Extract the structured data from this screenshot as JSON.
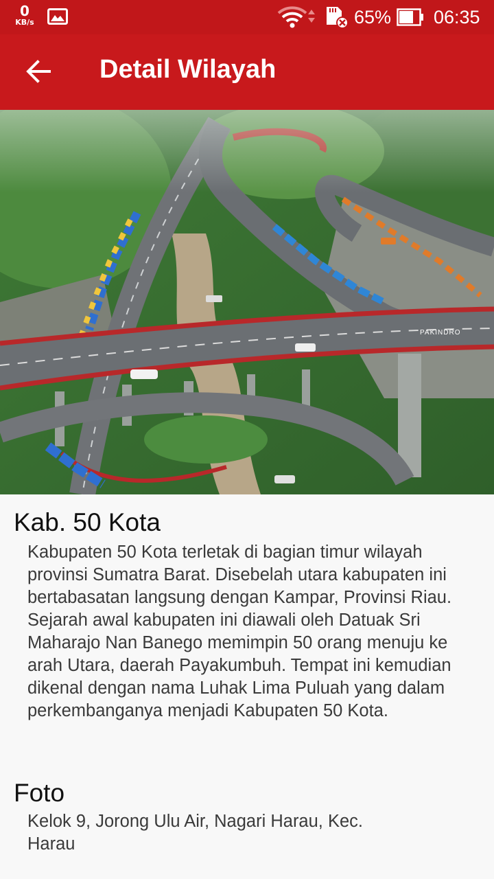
{
  "status_bar": {
    "net_speed_value": "0",
    "net_speed_unit": "KB/s",
    "battery_percent": "65%",
    "time": "06:35",
    "icons": [
      "gallery-icon",
      "wifi-icon",
      "sd-card-icon",
      "battery-icon"
    ]
  },
  "app_bar": {
    "title": "Detail Wilayah",
    "back_icon": "arrow-back-icon"
  },
  "hero": {
    "watermark": "PAKINDRO"
  },
  "detail": {
    "name": "Kab. 50 Kota",
    "description": "Kabupaten 50 Kota terletak di bagian timur wilayah provinsi Sumatra Barat. Disebelah utara kabupaten ini bertabasatan langsung dengan Kampar, Provinsi Riau. Sejarah awal kabupaten ini diawali oleh Datuak Sri Maharajo Nan Banego memimpin 50 orang menuju ke arah Utara, daerah Payakumbuh. Tempat ini kemudian dikenal dengan nama Luhak Lima Puluah yang dalam perkembanganya menjadi Kabupaten 50 Kota.",
    "photo_heading": "Foto",
    "photo_caption": "Kelok 9, Jorong Ulu Air, Nagari Harau, Kec. Harau"
  },
  "colors": {
    "status_bar": "#c1171a",
    "app_bar": "#c8191c",
    "background": "#f8f8f8"
  }
}
